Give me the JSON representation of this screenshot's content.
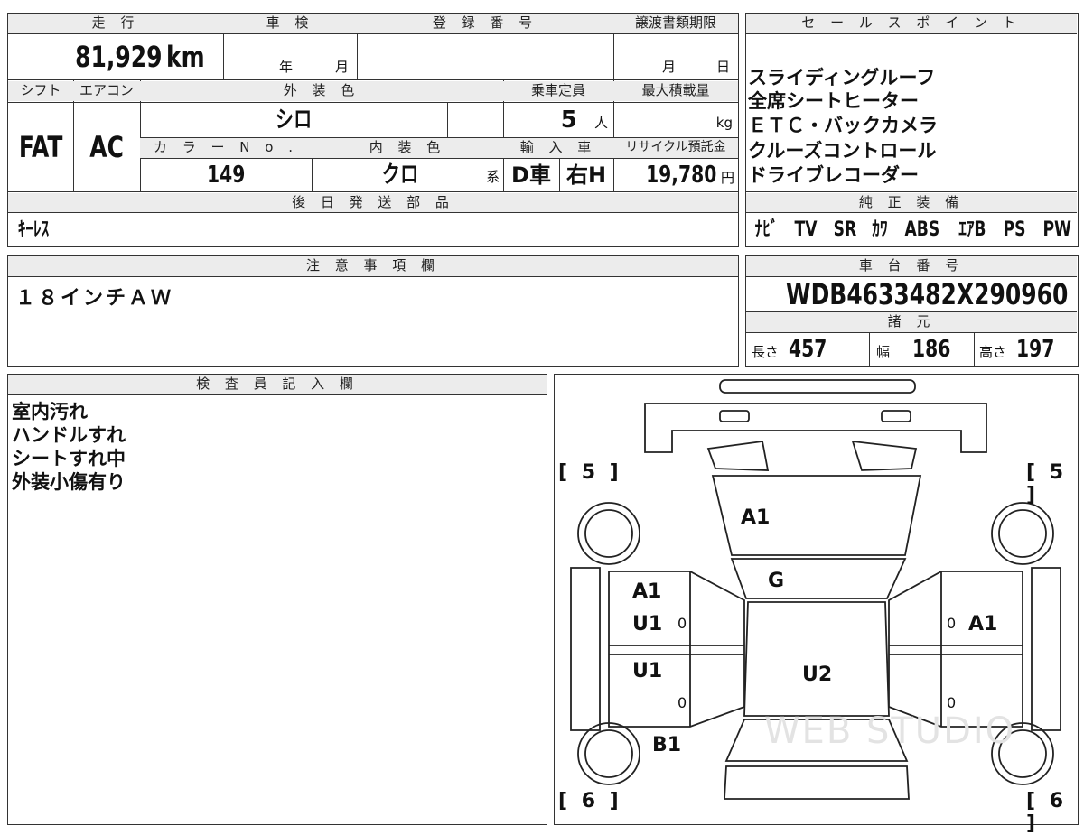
{
  "vehicle": {
    "mileage_header": "走 行",
    "mileage_value": "81,929",
    "mileage_unit": "km",
    "inspection_header": "車 検",
    "inspection_year_label": "年",
    "inspection_month_label": "月",
    "registration_header": "登 録 番 号",
    "transfer_deadline_header": "譲渡書類期限",
    "transfer_month_label": "月",
    "transfer_day_label": "日",
    "shift_header": "シフト",
    "shift_value": "FAT",
    "aircon_header": "エアコン",
    "aircon_value": "AC",
    "exterior_color_header": "外 装 色",
    "exterior_color_value": "シロ",
    "capacity_header": "乗車定員",
    "capacity_value": "5",
    "capacity_unit": "人",
    "max_load_header": "最大積載量",
    "max_load_unit": "kg",
    "color_no_header": "カ ラ ー N o .",
    "color_no_value": "149",
    "interior_color_header": "内 装 色",
    "interior_color_value": "クロ",
    "interior_color_suffix": "系",
    "import_header": "輸 入 車",
    "import_type": "D車",
    "steering": "右H",
    "recycle_header": "リサイクル預託金",
    "recycle_value": "19,780",
    "recycle_unit": "円",
    "later_parts_header": "後 日 発 送 部 品",
    "later_parts_value": "ｷｰﾚｽ"
  },
  "sales_points": {
    "header": "セ ー ル ス ポ イ ン ト",
    "items": [
      "スライディングルーフ",
      "全席シートヒーター",
      "ＥＴＣ・バックカメラ",
      "クルーズコントロール",
      "ドライブレコーダー"
    ]
  },
  "equipment": {
    "header": "純 正 装 備",
    "items": [
      "ﾅﾋﾞ",
      "TV",
      "SR",
      "ｶﾜ",
      "ABS",
      "ｴｱB",
      "PS",
      "PW"
    ]
  },
  "notes": {
    "header": "注 意 事 項 欄",
    "value": "１８インチＡＷ"
  },
  "chassis": {
    "header": "車 台 番 号",
    "value": "WDB4633482X290960",
    "spec_header": "諸 元",
    "length_label": "長さ",
    "length_value": "457",
    "width_label": "幅",
    "width_value": "186",
    "height_label": "高さ",
    "height_value": "197"
  },
  "inspector": {
    "header": "検 査 員 記 入 欄",
    "lines": [
      "室内汚れ",
      "ハンドルすれ",
      "シートすれ中",
      "外装小傷有り"
    ]
  },
  "diagram": {
    "tire_front_left": "[ 5 ]",
    "tire_front_right": "[ 5 ]",
    "tire_rear_left": "[ 6 ]",
    "tire_rear_right": "[ 6 ]",
    "hood": "A1",
    "windshield": "G",
    "front_left_fender_a": "A1",
    "front_left_fender_b": "U1",
    "rear_left_door": "U1",
    "roof": "U2",
    "rear_left_quarter": "B1",
    "right_side": "A1",
    "zero_a": "0",
    "zero_b": "0",
    "zero_c": "0",
    "zero_d": "0",
    "watermark": "WEB STUDIO"
  }
}
